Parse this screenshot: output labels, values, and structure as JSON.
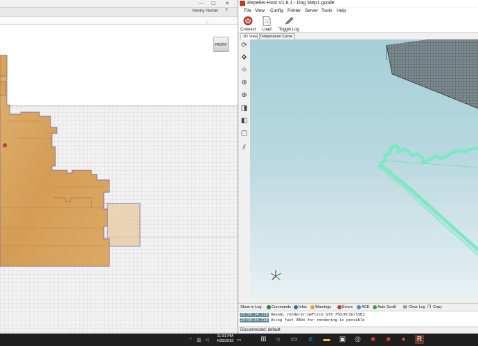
{
  "cad": {
    "user": "Kenny Horner",
    "viewcube_label": "FRONT"
  },
  "repetier": {
    "title": "Repetier-Host V1.6.1 - Dog Step1.gcode",
    "menu": [
      "File",
      "View",
      "Config",
      "Printer",
      "Server",
      "Tools",
      "Help"
    ],
    "toolbar": {
      "connect": "Connect",
      "load": "Load",
      "toggle_log": "Toggle Log"
    },
    "tabs": [
      "3D View",
      "Temperature Curve"
    ],
    "log_bar": {
      "show_in_log": "Show in Log:",
      "commands": "Commands",
      "infos": "Infos",
      "warnings": "Warnings",
      "errors": "Errors",
      "ack": "ACK",
      "auto_scroll": "Auto Scroll",
      "clear_log": "Clear Log",
      "copy": "Copy"
    },
    "log": [
      {
        "time": "23:50:34.118",
        "msg": "OpenGL renderer:GeForce GTX 750/PCIe/SSE2"
      },
      {
        "time": "23:50:34.118",
        "msg": "Using fast VBOs for rendering is possible"
      }
    ],
    "status": "Disconnected: default"
  },
  "taskbar": {
    "time": "11:51 PM",
    "date": "4/25/2016"
  },
  "colors": {
    "wood": "#d9a862",
    "print_path": "#7de8c4",
    "viewport_top": "#a6cfd9",
    "connect_red": "#b03a2e"
  }
}
